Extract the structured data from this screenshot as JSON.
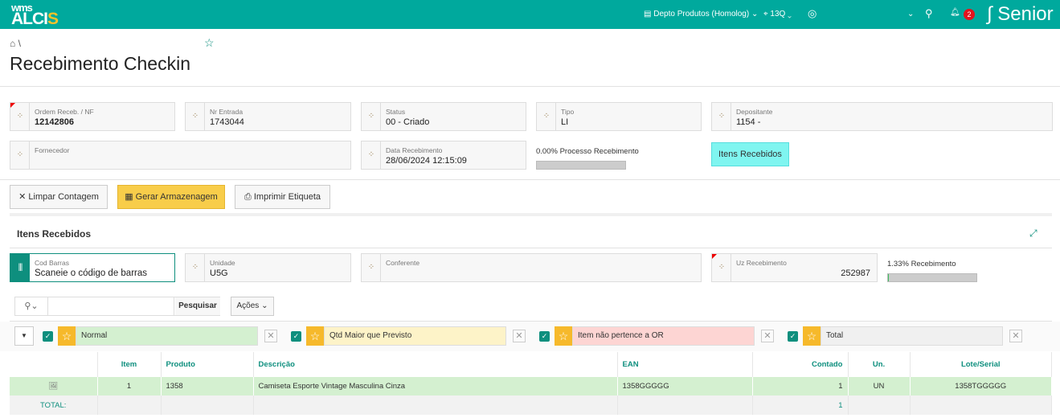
{
  "header": {
    "logo_top": "wms",
    "logo_main": "ALCI",
    "logo_accent": "S",
    "depot": "Depto Produtos (Homolog)",
    "location": "13Q",
    "notifications": "2",
    "brand": "Senior"
  },
  "breadcrumb": {
    "sep": "\\"
  },
  "page": {
    "title": "Recebimento Checkin"
  },
  "fields": {
    "ordem": {
      "label": "Ordem Receb. / NF",
      "value": "12142806"
    },
    "nr_entrada": {
      "label": "Nr Entrada",
      "value": "1743044"
    },
    "status": {
      "label": "Status",
      "value": "00 - Criado"
    },
    "tipo": {
      "label": "Tipo",
      "value": "LI"
    },
    "depositante": {
      "label": "Depositante",
      "value": "1154 -"
    },
    "fornecedor": {
      "label": "Fornecedor",
      "value": ""
    },
    "data": {
      "label": "Data Recebimento",
      "value": "28/06/2024 12:15:09"
    }
  },
  "process": {
    "label": "0.00% Processo Recebimento",
    "percent": 0
  },
  "itens_button": "Itens Recebidos",
  "actions": {
    "limpar": "Limpar Contagem",
    "gerar": "Gerar Armazenagem",
    "imprimir": "Imprimir Etiqueta"
  },
  "section": {
    "title": "Itens Recebidos",
    "cod_barras": {
      "label": "Cod Barras",
      "placeholder": "Scaneie o código de barras"
    },
    "unidade": {
      "label": "Unidade",
      "value": "U5G"
    },
    "conferente": {
      "label": "Conferente",
      "value": ""
    },
    "uz": {
      "label": "Uz Recebimento",
      "value": "252987"
    },
    "recebimento": {
      "label": "1.33% Recebimento",
      "percent": 1.33
    }
  },
  "toolbar": {
    "search_placeholder": "",
    "search_button": "Pesquisar",
    "acoes": "Ações"
  },
  "filters": [
    {
      "label": "Normal",
      "color": "#d4f0d0"
    },
    {
      "label": "Qtd Maior que Previsto",
      "color": "#fdf3c8"
    },
    {
      "label": "Item não pertence a OR",
      "color": "#fdd5d3"
    },
    {
      "label": "Total",
      "color": "#f0f0f0"
    }
  ],
  "table": {
    "headers": [
      "",
      "Item",
      "Produto",
      "Descrição",
      "EAN",
      "Contado",
      "Un.",
      "Lote/Serial"
    ],
    "rows": [
      [
        "",
        "1",
        "1358",
        "Camiseta Esporte Vintage Masculina Cinza",
        "1358GGGGG",
        "1",
        "UN",
        "1358TGGGGG"
      ]
    ],
    "total": {
      "label": "TOTAL:",
      "contado": "1"
    }
  }
}
